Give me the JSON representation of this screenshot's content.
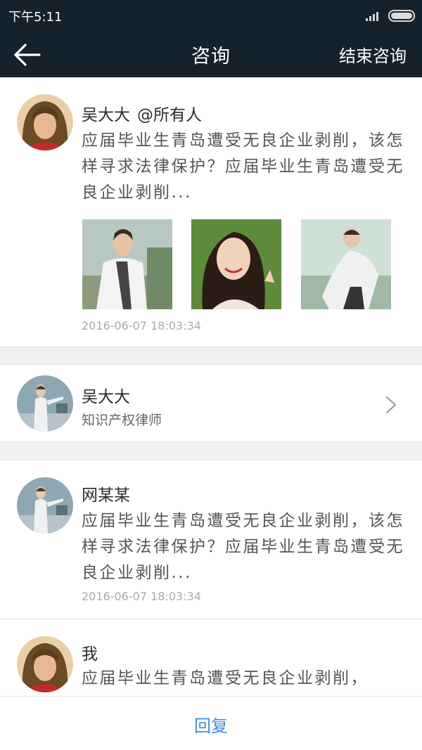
{
  "status": {
    "time": "下午5:11"
  },
  "header": {
    "title": "咨询",
    "end_button": "结束咨询"
  },
  "post": {
    "author": "吴大大",
    "mention": "@所有人",
    "text": "应届毕业生青岛遭受无良企业剥削，该怎样寻求法律保护？应届毕业生青岛遭受无良企业剥削...",
    "time": "2016-06-07 18:03:34"
  },
  "lawyer": {
    "name": "吴大大",
    "title": "知识产权律师"
  },
  "messages": [
    {
      "author": "网某某",
      "text": "应届毕业生青岛遭受无良企业剥削，该怎样寻求法律保护？应届毕业生青岛遭受无良企业剥削...",
      "time": "2016-06-07 18:03:34"
    },
    {
      "author": "我",
      "text": "应届毕业生青岛遭受无良企业剥削，"
    }
  ],
  "footer": {
    "reply": "回复"
  },
  "colors": {
    "header_bg": "#16222b",
    "accent": "#3a8fd9"
  }
}
